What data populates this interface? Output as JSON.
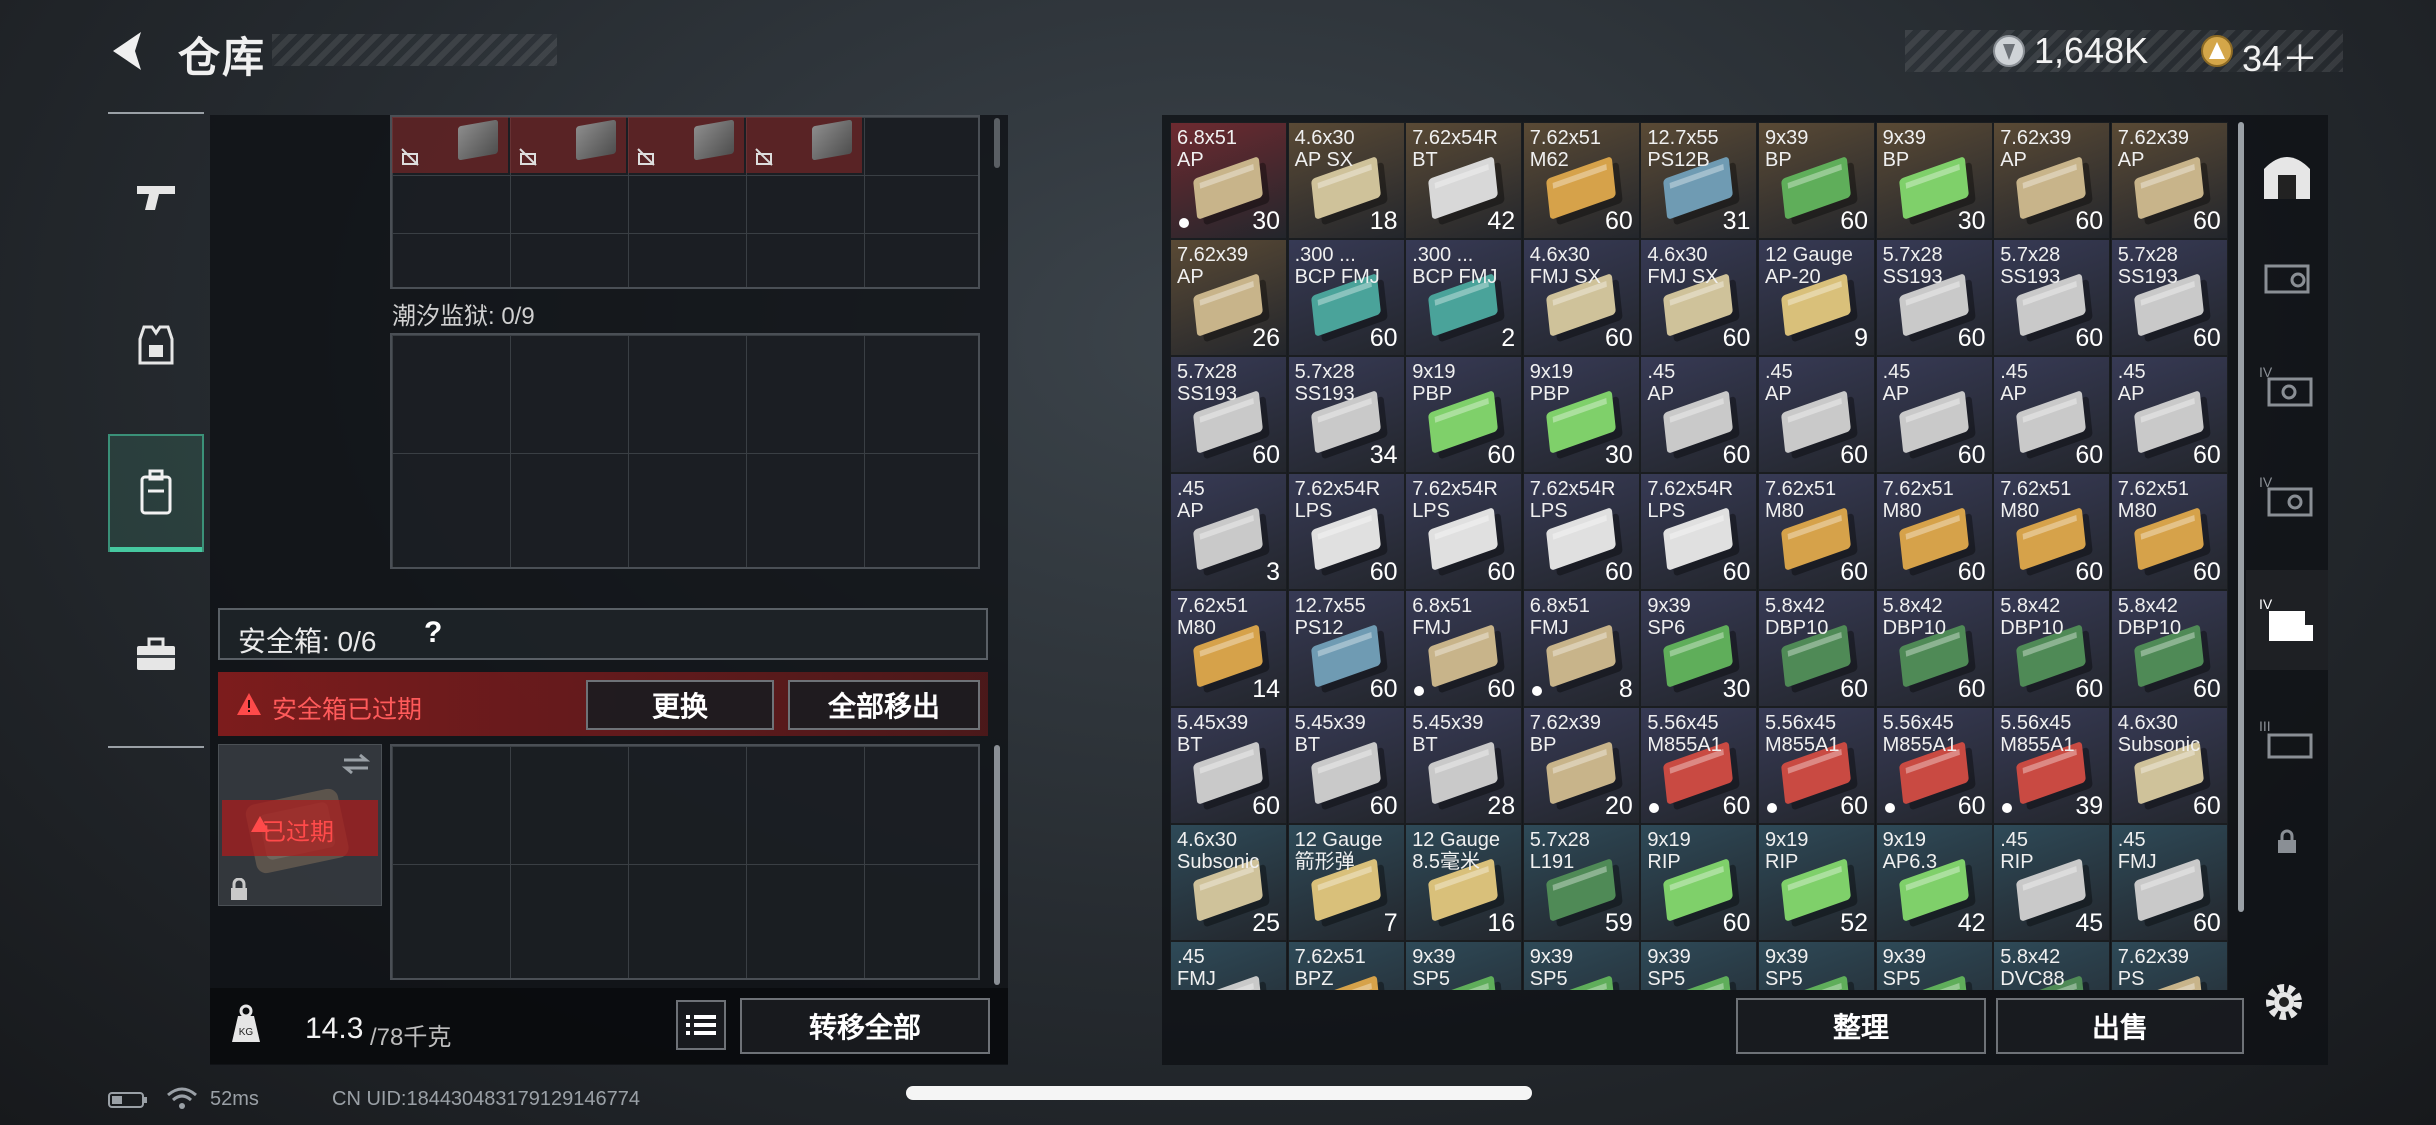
{
  "header": {
    "title": "仓库",
    "silver_amount": "1,648K",
    "gold_amount": "34＋"
  },
  "left_nav": {
    "items": [
      {
        "name": "weapons",
        "icon": "pistol-icon"
      },
      {
        "name": "armor",
        "icon": "vest-icon"
      },
      {
        "name": "backpack",
        "icon": "backpack-icon",
        "active": true
      },
      {
        "name": "supplies",
        "icon": "briefcase-icon"
      }
    ]
  },
  "container": {
    "prison_label": "潮汐监狱: 0/9",
    "safe_label": "安全箱: 0/6",
    "safe_help": "?",
    "expired_text": "安全箱已过期",
    "replace_label": "更换",
    "move_all_out_label": "全部移出",
    "case_expired_text": "已过期"
  },
  "weight": {
    "current": "14.3",
    "max": "/78千克"
  },
  "buttons": {
    "transfer_all": "转移全部",
    "sort": "整理",
    "sell": "出售"
  },
  "status_bar": {
    "ping": "52ms",
    "uid": "CN UID:18443048317912914677​4"
  },
  "inventory": [
    [
      {
        "cal": "6.8x51\nAP",
        "qty": "30",
        "bg": "#6e2a30",
        "box": "#c8b48a",
        "dot": true
      },
      {
        "cal": "4.6x30\nAP SX",
        "qty": "18",
        "bg": "#5a4a35",
        "box": "#cfc29a"
      },
      {
        "cal": "7.62x54R\nBT",
        "qty": "42",
        "bg": "#5a4a35",
        "box": "#d8d8d8"
      },
      {
        "cal": "7.62x51\nM62",
        "qty": "60",
        "bg": "#5a4a35",
        "box": "#d6a24a"
      },
      {
        "cal": "12.7x55\nPS12B",
        "qty": "31",
        "bg": "#5a4a35",
        "box": "#6f9bb3"
      },
      {
        "cal": "9x39\nBP",
        "qty": "60",
        "bg": "#5a4a35",
        "box": "#5fae5a"
      },
      {
        "cal": "9x39\nBP",
        "qty": "30",
        "bg": "#5a4a35",
        "box": "#7fd06a"
      },
      {
        "cal": "7.62x39\nAP",
        "qty": "60",
        "bg": "#5a4a35",
        "box": "#c8b48a"
      },
      {
        "cal": "7.62x39\nAP",
        "qty": "60",
        "bg": "#5a4a35",
        "box": "#c8b48a"
      }
    ],
    [
      {
        "cal": "7.62x39\nAP",
        "qty": "26",
        "bg": "#5a4a35",
        "box": "#c8b48a"
      },
      {
        "cal": ".300 ...\nBCP FMJ",
        "qty": "60",
        "bg": "#373a55",
        "box": "#4aa39a"
      },
      {
        "cal": ".300 ...\nBCP FMJ",
        "qty": "2",
        "bg": "#373a55",
        "box": "#4aa39a"
      },
      {
        "cal": "4.6x30\nFMJ SX",
        "qty": "60",
        "bg": "#373a55",
        "box": "#cfc29a"
      },
      {
        "cal": "4.6x30\nFMJ SX",
        "qty": "60",
        "bg": "#373a55",
        "box": "#cfc29a"
      },
      {
        "cal": "12 Gauge\nAP-20",
        "qty": "9",
        "bg": "#373a55",
        "box": "#d9c07a"
      },
      {
        "cal": "5.7x28\nSS193",
        "qty": "60",
        "bg": "#373a55",
        "box": "#c9c9c9"
      },
      {
        "cal": "5.7x28\nSS193",
        "qty": "60",
        "bg": "#373a55",
        "box": "#c9c9c9"
      },
      {
        "cal": "5.7x28\nSS193",
        "qty": "60",
        "bg": "#373a55",
        "box": "#c9c9c9"
      }
    ],
    [
      {
        "cal": "5.7x28\nSS193",
        "qty": "60",
        "bg": "#373a55",
        "box": "#c9c9c9"
      },
      {
        "cal": "5.7x28\nSS193",
        "qty": "34",
        "bg": "#373a55",
        "box": "#c9c9c9"
      },
      {
        "cal": "9x19\nPBP",
        "qty": "60",
        "bg": "#373a55",
        "box": "#7fd06a"
      },
      {
        "cal": "9x19\nPBP",
        "qty": "30",
        "bg": "#373a55",
        "box": "#7fd06a"
      },
      {
        "cal": ".45\nAP",
        "qty": "60",
        "bg": "#373a55",
        "box": "#c9c9c9"
      },
      {
        "cal": ".45\nAP",
        "qty": "60",
        "bg": "#373a55",
        "box": "#c9c9c9"
      },
      {
        "cal": ".45\nAP",
        "qty": "60",
        "bg": "#373a55",
        "box": "#c9c9c9"
      },
      {
        "cal": ".45\nAP",
        "qty": "60",
        "bg": "#373a55",
        "box": "#c9c9c9"
      },
      {
        "cal": ".45\nAP",
        "qty": "60",
        "bg": "#373a55",
        "box": "#c9c9c9"
      }
    ],
    [
      {
        "cal": ".45\nAP",
        "qty": "3",
        "bg": "#373a55",
        "box": "#c9c9c9"
      },
      {
        "cal": "7.62x54R\nLPS",
        "qty": "60",
        "bg": "#373a55",
        "box": "#e0e0e0"
      },
      {
        "cal": "7.62x54R\nLPS",
        "qty": "60",
        "bg": "#373a55",
        "box": "#e0e0e0"
      },
      {
        "cal": "7.62x54R\nLPS",
        "qty": "60",
        "bg": "#373a55",
        "box": "#e0e0e0"
      },
      {
        "cal": "7.62x54R\nLPS",
        "qty": "60",
        "bg": "#373a55",
        "box": "#e0e0e0"
      },
      {
        "cal": "7.62x51\nM80",
        "qty": "60",
        "bg": "#373a55",
        "box": "#d6a24a"
      },
      {
        "cal": "7.62x51\nM80",
        "qty": "60",
        "bg": "#373a55",
        "box": "#d6a24a"
      },
      {
        "cal": "7.62x51\nM80",
        "qty": "60",
        "bg": "#373a55",
        "box": "#d6a24a"
      },
      {
        "cal": "7.62x51\nM80",
        "qty": "60",
        "bg": "#373a55",
        "box": "#d6a24a"
      }
    ],
    [
      {
        "cal": "7.62x51\nM80",
        "qty": "14",
        "bg": "#373a55",
        "box": "#d6a24a"
      },
      {
        "cal": "12.7x55\nPS12",
        "qty": "60",
        "bg": "#373a55",
        "box": "#6f9bb3"
      },
      {
        "cal": "6.8x51\nFMJ",
        "qty": "60",
        "bg": "#373a55",
        "box": "#c8b48a",
        "dot": true
      },
      {
        "cal": "6.8x51\nFMJ",
        "qty": "8",
        "bg": "#373a55",
        "box": "#c8b48a",
        "dot": true
      },
      {
        "cal": "9x39\nSP6",
        "qty": "30",
        "bg": "#373a55",
        "box": "#5fae5a"
      },
      {
        "cal": "5.8x42\nDBP10",
        "qty": "60",
        "bg": "#373a55",
        "box": "#4f8a56"
      },
      {
        "cal": "5.8x42\nDBP10",
        "qty": "60",
        "bg": "#373a55",
        "box": "#4f8a56"
      },
      {
        "cal": "5.8x42\nDBP10",
        "qty": "60",
        "bg": "#373a55",
        "box": "#4f8a56"
      },
      {
        "cal": "5.8x42\nDBP10",
        "qty": "60",
        "bg": "#373a55",
        "box": "#4f8a56"
      }
    ],
    [
      {
        "cal": "5.45x39\nBT",
        "qty": "60",
        "bg": "#373a55",
        "box": "#c9c9c9"
      },
      {
        "cal": "5.45x39\nBT",
        "qty": "60",
        "bg": "#373a55",
        "box": "#c9c9c9"
      },
      {
        "cal": "5.45x39\nBT",
        "qty": "28",
        "bg": "#373a55",
        "box": "#c9c9c9"
      },
      {
        "cal": "7.62x39\nBP",
        "qty": "20",
        "bg": "#373a55",
        "box": "#c8b48a"
      },
      {
        "cal": "5.56x45\nM855A1",
        "qty": "60",
        "bg": "#373a55",
        "box": "#c94a42",
        "dot": true
      },
      {
        "cal": "5.56x45\nM855A1",
        "qty": "60",
        "bg": "#373a55",
        "box": "#c94a42",
        "dot": true
      },
      {
        "cal": "5.56x45\nM855A1",
        "qty": "60",
        "bg": "#373a55",
        "box": "#c94a42",
        "dot": true
      },
      {
        "cal": "5.56x45\nM855A1",
        "qty": "39",
        "bg": "#373a55",
        "box": "#c94a42",
        "dot": true
      },
      {
        "cal": "4.6x30\nSubsonic",
        "qty": "60",
        "bg": "#373a55",
        "box": "#cfc29a"
      }
    ],
    [
      {
        "cal": "4.6x30\nSubsonic",
        "qty": "25",
        "bg": "#2e4a58",
        "box": "#cfc29a"
      },
      {
        "cal": "12 Gauge\n箭形弹",
        "qty": "7",
        "bg": "#2e4a58",
        "box": "#d9c07a"
      },
      {
        "cal": "12 Gauge\n8.5毫米",
        "qty": "16",
        "bg": "#2e4a58",
        "box": "#d9c07a"
      },
      {
        "cal": "5.7x28\nL191",
        "qty": "59",
        "bg": "#2e4a58",
        "box": "#4f8a56"
      },
      {
        "cal": "9x19\nRIP",
        "qty": "60",
        "bg": "#2e4a58",
        "box": "#7fd06a"
      },
      {
        "cal": "9x19\nRIP",
        "qty": "52",
        "bg": "#2e4a58",
        "box": "#7fd06a"
      },
      {
        "cal": "9x19\nAP6.3",
        "qty": "42",
        "bg": "#2e4a58",
        "box": "#7fd06a"
      },
      {
        "cal": ".45\nRIP",
        "qty": "45",
        "bg": "#2e4a58",
        "box": "#c9c9c9"
      },
      {
        "cal": ".45\nFMJ",
        "qty": "60",
        "bg": "#2e4a58",
        "box": "#c9c9c9"
      }
    ],
    [
      {
        "cal": ".45\nFMJ",
        "qty": "",
        "bg": "#2e4a58",
        "box": "#c9c9c9"
      },
      {
        "cal": "7.62x51\nBPZ",
        "qty": "",
        "bg": "#2e4a58",
        "box": "#d6a24a"
      },
      {
        "cal": "9x39\nSP5",
        "qty": "",
        "bg": "#2e4a58",
        "box": "#5fae5a"
      },
      {
        "cal": "9x39\nSP5",
        "qty": "",
        "bg": "#2e4a58",
        "box": "#5fae5a"
      },
      {
        "cal": "9x39\nSP5",
        "qty": "",
        "bg": "#2e4a58",
        "box": "#5fae5a"
      },
      {
        "cal": "9x39\nSP5",
        "qty": "",
        "bg": "#2e4a58",
        "box": "#5fae5a"
      },
      {
        "cal": "9x39\nSP5",
        "qty": "",
        "bg": "#2e4a58",
        "box": "#5fae5a"
      },
      {
        "cal": "5.8x42\nDVC88",
        "qty": "",
        "bg": "#2e4a58",
        "box": "#4f8a56"
      },
      {
        "cal": "7.62x39\nPS",
        "qty": "",
        "bg": "#2e4a58",
        "box": "#c8b48a"
      }
    ]
  ],
  "right_nav": [
    {
      "name": "locker",
      "icon": "locker-icon"
    },
    {
      "name": "container-1",
      "icon": "container-icon"
    },
    {
      "name": "container-iv-a",
      "icon": "container-iv-icon"
    },
    {
      "name": "container-iv-b",
      "icon": "container-iv-icon"
    },
    {
      "name": "container-iv-c",
      "icon": "container-iv-icon",
      "active": true
    },
    {
      "name": "container-iii",
      "icon": "container-iii-icon"
    },
    {
      "name": "locked",
      "icon": "lock-icon"
    }
  ]
}
